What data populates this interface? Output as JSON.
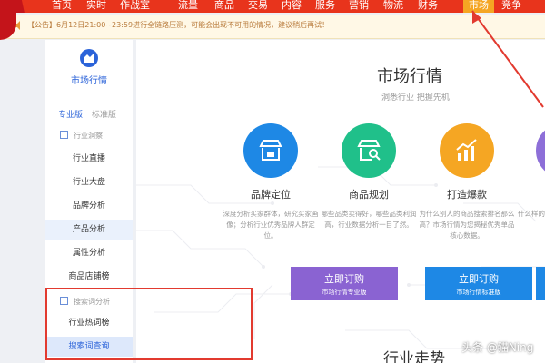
{
  "top_nav": {
    "items": [
      "首页",
      "实时",
      "作战室",
      "流量",
      "商品",
      "交易",
      "内容",
      "服务",
      "营销",
      "物流",
      "财务",
      "市场",
      "竞争"
    ],
    "active_index": 11
  },
  "notice": {
    "text": "【公告】6月12日21:00~23:59进行全链路压测，可能会出现不可用的情况，建议稍后再试！"
  },
  "sidebar": {
    "title": "市场行情",
    "tabs": [
      "专业版",
      "标准版"
    ],
    "group1": "行业洞察",
    "group1_items": [
      "行业直播",
      "行业大盘",
      "品牌分析",
      "产品分析",
      "属性分析",
      "商品店铺榜"
    ],
    "group2": "搜索词分析",
    "group2_items": [
      "行业热词榜",
      "搜索词查询"
    ]
  },
  "main": {
    "title": "市场行情",
    "subtitle": "洞悉行业 把握先机",
    "features": [
      {
        "name": "品牌定位",
        "desc": "深度分析买家群体，研究买家画像；分析行业优秀品牌人群定位。",
        "color": "#1e88e5",
        "icon": "storefront-icon"
      },
      {
        "name": "商品规划",
        "desc": "哪些品类卖得好，哪些品类利润高，行业数据分析一目了然。",
        "color": "#20c08a",
        "icon": "shop-search-icon"
      },
      {
        "name": "打造爆款",
        "desc": "为什么别人的商品搜索排名那么高？市场行情为您揭秘优秀单品核心数据。",
        "color": "#f5a623",
        "icon": "chart-up-icon"
      },
      {
        "name": "",
        "desc": "什么样的流量",
        "color": "#8d6fd8",
        "icon": ""
      }
    ],
    "buy_buttons": [
      {
        "label": "立即订购",
        "sub": "市场行情专业版",
        "color": "#8a63d2"
      },
      {
        "label": "立即订购",
        "sub": "市场行情标准版",
        "color": "#1e88e5"
      }
    ],
    "section_title": "行业走势"
  },
  "watermark": "头条 @猫Ning"
}
